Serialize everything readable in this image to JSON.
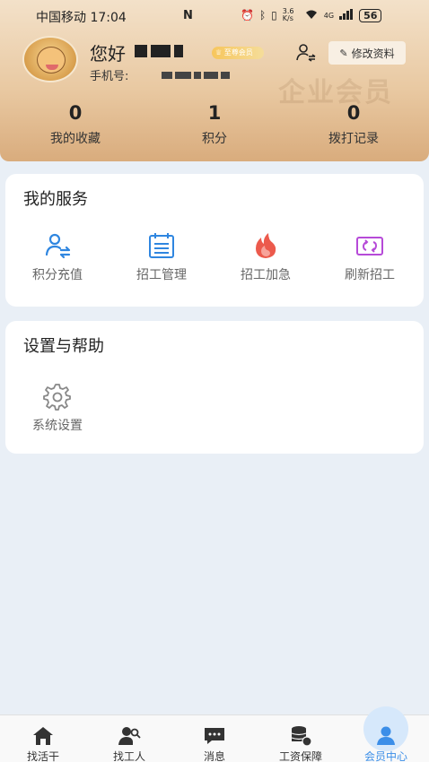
{
  "status_bar": {
    "carrier_time": "中国移动 17:04",
    "net_speed": "3.6 K/s",
    "signal": "4G",
    "battery": "56"
  },
  "profile": {
    "greeting": "您好",
    "vip_badge": "至尊会员",
    "phone_label": "手机号:",
    "edit_label": "修改资料",
    "watermark": "企业会员"
  },
  "stats": [
    {
      "value": "0",
      "label": "我的收藏"
    },
    {
      "value": "1",
      "label": "积分"
    },
    {
      "value": "0",
      "label": "拨打记录"
    }
  ],
  "services": {
    "title": "我的服务",
    "items": [
      {
        "label": "积分充值",
        "icon": "user-exchange-icon",
        "color": "#2f86e0"
      },
      {
        "label": "招工管理",
        "icon": "calendar-list-icon",
        "color": "#2f86e0"
      },
      {
        "label": "招工加急",
        "icon": "flame-icon",
        "color": "#ec5a4c"
      },
      {
        "label": "刷新招工",
        "icon": "refresh-icon",
        "color": "#b64ad8"
      }
    ]
  },
  "settings": {
    "title": "设置与帮助",
    "items": [
      {
        "label": "系统设置",
        "icon": "gear-icon"
      }
    ]
  },
  "bottom_nav": {
    "items": [
      {
        "label": "找活干",
        "icon": "home-icon"
      },
      {
        "label": "找工人",
        "icon": "worker-search-icon"
      },
      {
        "label": "消息",
        "icon": "message-icon"
      },
      {
        "label": "工资保障",
        "icon": "money-shield-icon"
      },
      {
        "label": "会员中心",
        "icon": "member-icon",
        "active": true
      }
    ],
    "active_color": "#3b8ee8"
  }
}
